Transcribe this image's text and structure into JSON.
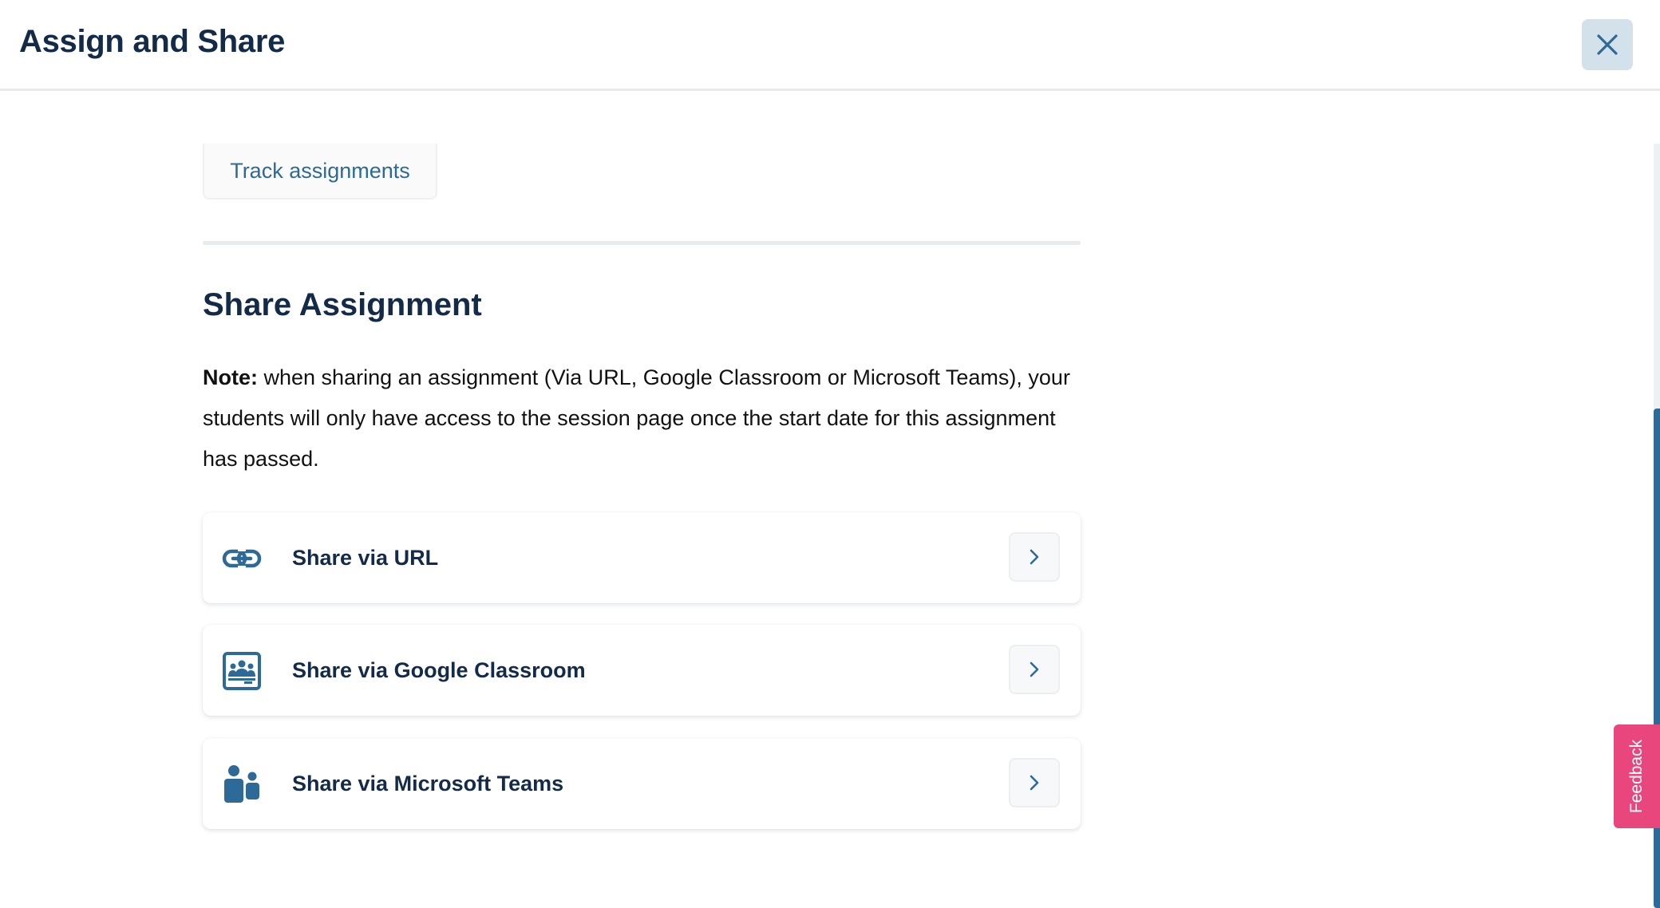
{
  "header": {
    "title": "Assign and Share",
    "close_icon": "close-icon"
  },
  "track": {
    "label": "Track assignments"
  },
  "share": {
    "title": "Share Assignment",
    "note_label": "Note:",
    "note_text": " when sharing an assignment (Via URL, Google Classroom or Microsoft Teams), your students will only have access to the session page once the start date for this assignment has passed.",
    "options": [
      {
        "label": "Share via URL",
        "icon": "link-icon"
      },
      {
        "label": "Share via Google Classroom",
        "icon": "google-classroom-icon"
      },
      {
        "label": "Share via Microsoft Teams",
        "icon": "microsoft-teams-icon"
      }
    ]
  },
  "feedback": {
    "label": "Feedback"
  },
  "colors": {
    "primary": "#2d6a97",
    "heading": "#132b48",
    "close_bg": "#d3e1eb",
    "feedback_bg": "#e8467c"
  }
}
